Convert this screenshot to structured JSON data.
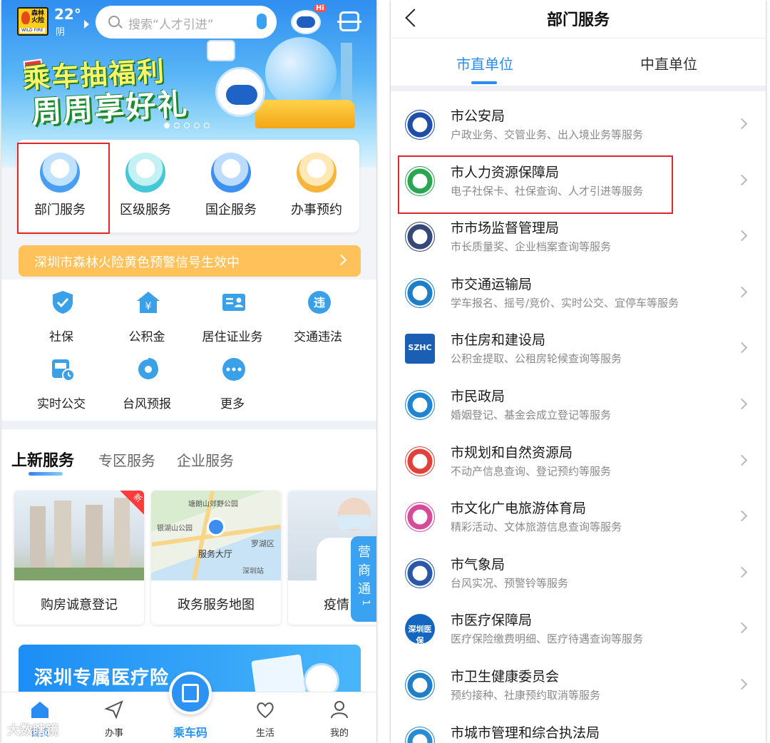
{
  "left": {
    "weather": {
      "badge_line1": "森林\n火险",
      "badge_line2": "WILD FIRE",
      "temp": "22°",
      "cond": "阴"
    },
    "search": {
      "placeholder": "搜索“人才引进”"
    },
    "robot_badge": "Hi",
    "banner": {
      "line1": "乘车抽福利",
      "line2": "周周享好礼",
      "page_count": 5,
      "active_page": 1
    },
    "categories": [
      {
        "label": "部门服务",
        "highlighted": true,
        "icon": "department-icon",
        "color": "#4a9ef2"
      },
      {
        "label": "区级服务",
        "icon": "district-icon",
        "color": "#46c7d6"
      },
      {
        "label": "国企服务",
        "icon": "soe-icon",
        "color": "#3d8ff0"
      },
      {
        "label": "办事预约",
        "icon": "appointment-icon",
        "color": "#f5b53a"
      }
    ],
    "alert": {
      "text": "深圳市森林火险黄色预警信号生效中"
    },
    "quick": [
      {
        "label": "社保",
        "icon": "shield-check-icon",
        "color": "#3aa0e8"
      },
      {
        "label": "公积金",
        "icon": "house-yuan-icon",
        "color": "#3aa0e8"
      },
      {
        "label": "居住证业务",
        "icon": "id-card-icon",
        "color": "#3aa0e8"
      },
      {
        "label": "交通违法",
        "icon": "violation-icon",
        "color": "#3aa0e8"
      },
      {
        "label": "实时公交",
        "icon": "bus-clock-icon",
        "color": "#3aa0e8"
      },
      {
        "label": "台风预报",
        "icon": "typhoon-icon",
        "color": "#3aa0e8"
      },
      {
        "label": "更多",
        "icon": "more-icon",
        "color": "#3aa0e8"
      }
    ],
    "service_tabs": [
      "上新服务",
      "专区服务",
      "企业服务"
    ],
    "service_cards": [
      {
        "label": "购房诚意登记",
        "tag": "新"
      },
      {
        "label": "政务服务地图",
        "map_labels": [
          "塘朗山郊野公园",
          "银湖山公园",
          "服务大厅",
          "罗湖区",
          "深圳站"
        ]
      },
      {
        "label": "疫情"
      }
    ],
    "float_tab": "营商通",
    "float_tab_suffix": "1",
    "med_banner": "深圳专属医疗险",
    "nav": [
      {
        "label": "首页",
        "icon": "home-icon"
      },
      {
        "label": "办事",
        "icon": "send-icon"
      },
      {
        "label": "乘车码",
        "icon": "qr-bus-icon"
      },
      {
        "label": "生活",
        "icon": "heart-icon"
      },
      {
        "label": "我的",
        "icon": "user-icon"
      }
    ],
    "watermark": "大数瞎镜"
  },
  "right": {
    "title": "部门服务",
    "tabs": [
      {
        "label": "市直单位",
        "active": true
      },
      {
        "label": "中直单位",
        "active": false
      }
    ],
    "depts": [
      {
        "name": "市公安局",
        "desc": "户政业务、交管业务、出入境业务等服务",
        "logo": "police-emblem-icon",
        "color": "#1d4fa8",
        "highlighted": false
      },
      {
        "name": "市人力资源保障局",
        "desc": "电子社保卡、社保查询、人才引进等服务",
        "logo": "tree-emblem-icon",
        "color": "#2aa652",
        "highlighted": true
      },
      {
        "name": "市市场监督管理局",
        "desc": "市长质量奖、企业档案查询等服务",
        "logo": "market-emblem-icon",
        "color": "#36477a",
        "highlighted": false
      },
      {
        "name": "市交通运输局",
        "desc": "学车报名、摇号/竞价、实时公交、宜停车等服务",
        "logo": "transport-emblem-icon",
        "color": "#1f7fc6",
        "highlighted": false
      },
      {
        "name": "市住房和建设局",
        "desc": "公积金提取、公租房轮候查询等服务",
        "logo": "szhc-logo-icon",
        "logo_text": "SZHC",
        "color": "#1a5fb4",
        "highlighted": false
      },
      {
        "name": "市民政局",
        "desc": "婚姻登记、基金会成立登记等服务",
        "logo": "civil-affairs-icon",
        "color": "#1f84d2",
        "highlighted": false
      },
      {
        "name": "市规划和自然资源局",
        "desc": "不动产信息查询、登记预约等服务",
        "logo": "planning-icon",
        "color": "#e0413b",
        "highlighted": false
      },
      {
        "name": "市文化广电旅游体育局",
        "desc": "精彩活动、文体旅游信息查询等服务",
        "logo": "culture-icon",
        "color": "#d64a9a",
        "highlighted": false
      },
      {
        "name": "市气象局",
        "desc": "台风实况、预警铃等服务",
        "logo": "weather-emblem-icon",
        "color": "#2a58a8",
        "highlighted": false
      },
      {
        "name": "市医疗保障局",
        "desc": "医疗保险缴费明细、医疗待遇查询等服务",
        "logo": "medical-insurance-icon",
        "logo_text": "深圳医保",
        "color": "#1566c0",
        "highlighted": false
      },
      {
        "name": "市卫生健康委员会",
        "desc": "预约接种、社康预约取消等服务",
        "logo": "health-emblem-icon",
        "color": "#1f7fc6",
        "highlighted": false
      },
      {
        "name": "市城市管理和综合执法局",
        "desc": "",
        "logo": "urban-mgmt-icon",
        "color": "#2a8cd0",
        "highlighted": false
      }
    ]
  },
  "colors": {
    "accent": "#2a8cf0",
    "highlight_border": "#e0262a",
    "alert_bg": "#ffc25a"
  }
}
